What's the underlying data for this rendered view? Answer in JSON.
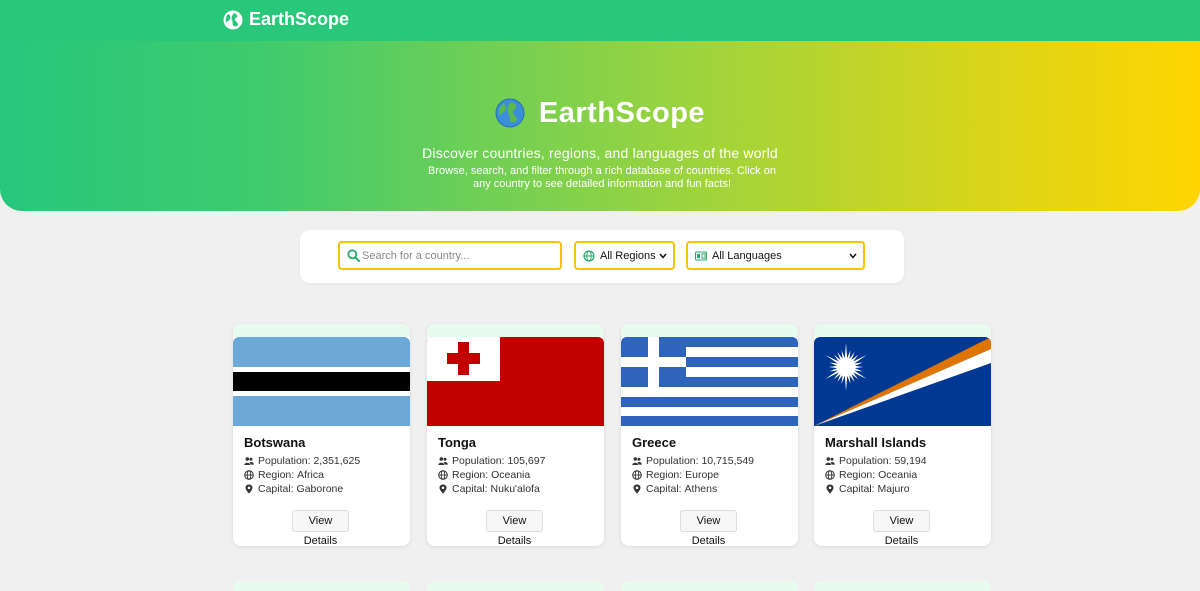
{
  "nav": {
    "brand": "EarthScope"
  },
  "hero": {
    "title": "EarthScope",
    "subtitle": "Discover countries, regions, and languages of the world",
    "description": "Browse, search, and filter through a rich database of countries. Click on any country to see detailed information and fun facts!"
  },
  "filters": {
    "search_placeholder": "Search for a country...",
    "region_selected": "All Regions",
    "language_selected": "All Languages"
  },
  "labels": {
    "population": "Population:",
    "region": "Region:",
    "capital": "Capital:",
    "view_details": "View Details"
  },
  "countries": [
    {
      "name": "Botswana",
      "population": "2,351,625",
      "region": "Africa",
      "capital": "Gaborone"
    },
    {
      "name": "Tonga",
      "population": "105,697",
      "region": "Oceania",
      "capital": "Nuku'alofa"
    },
    {
      "name": "Greece",
      "population": "10,715,549",
      "region": "Europe",
      "capital": "Athens"
    },
    {
      "name": "Marshall Islands",
      "population": "59,194",
      "region": "Oceania",
      "capital": "Majuro"
    }
  ],
  "colors": {
    "nav_green": "#28c77a",
    "hero_start": "#26c77c",
    "hero_end": "#ffd500",
    "input_border": "#f5c400"
  }
}
